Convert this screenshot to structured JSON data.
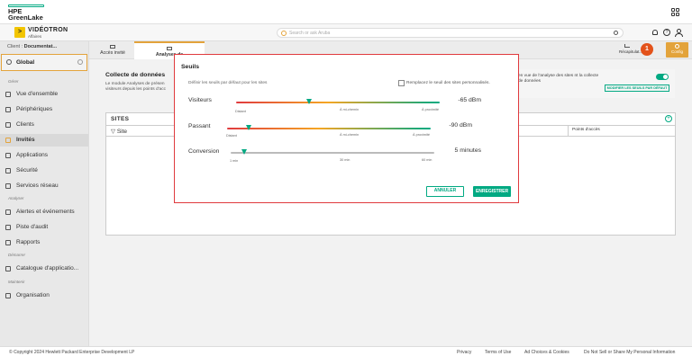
{
  "header": {
    "logo_line1": "HPE",
    "logo_line2": "GreenLake"
  },
  "appbar": {
    "brand_name": "VIDÉOTRON",
    "brand_sub": "Affaires",
    "brand_mark": ">",
    "search_placeholder": "Search or ask Aruba",
    "help_glyph": "?"
  },
  "sidebar": {
    "client_prefix": "Client : ",
    "client_name": "Documentat...",
    "global_label": "Global",
    "sections": {
      "manage": "Gérer",
      "analyze": "Analyser",
      "start": "Démarrer",
      "maintain": "Maintenir"
    },
    "items": [
      {
        "label": "Vue d'ensemble"
      },
      {
        "label": "Périphériques"
      },
      {
        "label": "Clients"
      },
      {
        "label": "Invités"
      },
      {
        "label": "Applications"
      },
      {
        "label": "Sécurité"
      },
      {
        "label": "Services réseau"
      },
      {
        "label": "Alertes et événements"
      },
      {
        "label": "Piste d'audit"
      },
      {
        "label": "Rapports"
      },
      {
        "label": "Catalogue d'applicatio..."
      },
      {
        "label": "Organisation"
      }
    ]
  },
  "tabs": {
    "guest_access": "Accès invité",
    "analytics": "Analyses de",
    "summary": "Récapitulat...",
    "config": "Config",
    "badge": "1"
  },
  "collect": {
    "title": "Collecte de données",
    "desc": "Le module Analyses de présen visiteurs depuis les points d'acc",
    "right_text": "en vue de l'analyse des sites nt la collecte de données",
    "thresholds_btn": "MODIFIER LES SEUILS PAR DÉFAUT"
  },
  "sites": {
    "title": "SITES",
    "col_site": "Site",
    "col_ap": "Points d'accès"
  },
  "modal": {
    "title": "Seuils",
    "desc": "Définir les seuils par défaut pour les sites",
    "override_label": "Remplacez le seuil des sites personnalisés.",
    "sliders": [
      {
        "label": "Visiteurs",
        "value": "-65 dBm",
        "ticks": [
          "Distant",
          "À mi-chemin",
          "À proximité"
        ],
        "position": 0.36
      },
      {
        "label": "Passant",
        "value": "-90 dBm",
        "ticks": [
          "Distant",
          "À mi-chemin",
          "À proximité"
        ],
        "position": 0.11
      },
      {
        "label": "Conversion",
        "value": "5 minutes",
        "ticks": [
          "1 min",
          "30 min",
          "60 min"
        ],
        "position": 0.07
      }
    ],
    "cancel": "ANNULER",
    "save": "ENREGISTRER"
  },
  "footer": {
    "copyright": "© Copyright 2024 Hewlett Packard Enterprise Development LP",
    "links": [
      "Privacy",
      "Terms of Use",
      "Ad Choices & Cookies",
      "Do Not Sell or Share My Personal Information"
    ]
  }
}
